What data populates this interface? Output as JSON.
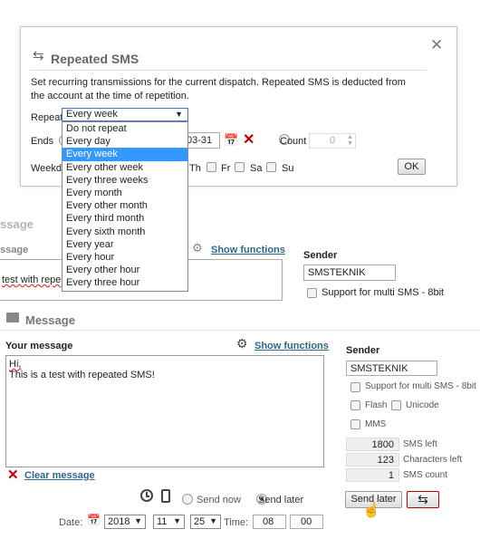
{
  "background_page": {
    "section_title_partial": "ssage",
    "label_partial": "ssage",
    "show_functions": "Show functions",
    "sender_label": "Sender",
    "sender_value": "SMSTEKNIK",
    "multi_sms_label": "Support for multi SMS - 8bit",
    "message_partial": "test with repe"
  },
  "dialog": {
    "title": "Repeated SMS",
    "description": "Set recurring transmissions for the current dispatch. Repeated SMS is deducted from the account at the time of repetition.",
    "repeat_label": "Repeat",
    "repeat_selected": "Every week",
    "ends_label": "Ends",
    "date_partial": "03-31",
    "count_label": "Count",
    "count_value": "0",
    "weekdays_label": "Weekda",
    "days": {
      "th": "Th",
      "fr": "Fr",
      "sa": "Sa",
      "su": "Su"
    },
    "ok_label": "OK"
  },
  "repeat_options": [
    "Do not repeat",
    "Every day",
    "Every week",
    "Every other week",
    "Every three weeks",
    "Every month",
    "Every other month",
    "Every third month",
    "Every sixth month",
    "Every year",
    "Every hour",
    "Every other hour",
    "Every three hour"
  ],
  "repeat_highlight_color": "#3399ff",
  "message": {
    "section_title": "Message",
    "your_message_label": "Your message",
    "show_functions": "Show functions",
    "text_line1": "Hi,",
    "text_line2": "This is a test with repeated SMS!",
    "clear_label": "Clear message"
  },
  "sender": {
    "label": "Sender",
    "value": "SMSTEKNIK",
    "multi_sms_label": "Support for multi SMS - 8bit",
    "flash_label": "Flash",
    "unicode_label": "Unicode",
    "mms_label": "MMS",
    "sms_left_value": "1800",
    "sms_left_label": "SMS left",
    "chars_left_value": "123",
    "chars_left_label": "Characters left",
    "sms_count_value": "1",
    "sms_count_label": "SMS count"
  },
  "send": {
    "send_now_label": "Send now",
    "send_later_label": "Send later",
    "send_later_button": "Send later",
    "date_label": "Date:",
    "year": "2018",
    "month": "11",
    "day": "25",
    "time_label": "Time:",
    "hour": "08",
    "minute": "00"
  },
  "colors": {
    "accent_red": "#c00000",
    "link": "#2b6a8a"
  }
}
